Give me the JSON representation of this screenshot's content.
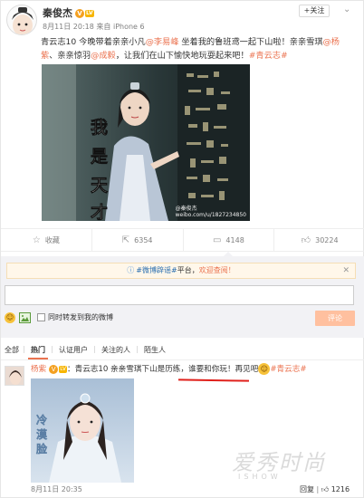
{
  "post": {
    "author": "秦俊杰",
    "time": "8月11日 20:18",
    "source_prefix": "来自",
    "source": "iPhone 6",
    "follow_label": "+关注",
    "text_line1_a": "青云志10 今晚带着亲亲小凡",
    "mention1": "@李易峰",
    "text_line1_b": " 坐着我的鲁班鸢一起下山啦！亲亲雪琪",
    "mention2": "@杨",
    "mention2_cont": "紫",
    "text_line2_a": "、亲亲惊羽",
    "mention3": "@成毅",
    "text_line2_b": "，让我们在山下愉快地玩耍起来吧！",
    "hashtag": "#青云志#",
    "image_caption": "我是天才",
    "image_watermark": "weibo.com/u/1827234850",
    "image_watermark2": "@秦俊杰"
  },
  "actions": {
    "favorite": "收藏",
    "repost": "6354",
    "comment": "4148",
    "like": "30224"
  },
  "comment_box": {
    "notice_link": "#微博辟谣#",
    "notice_text": "平台，",
    "notice_cta": "欢迎查阅！",
    "checkbox_label": "同时转发到我的微博",
    "submit_label": "评论"
  },
  "filters": {
    "all": "全部",
    "hot": "热门",
    "verified": "认证用户",
    "following": "关注的人",
    "strangers": "陌生人"
  },
  "comment": {
    "author": "杨紫",
    "text_a": "：青云志10 亲亲雪琪下山是历练，",
    "text_b": "谁要和你玩！再见吧",
    "hashtag": "#青云志#",
    "image_caption": "冷漠脸",
    "time": "8月11日 20:35",
    "reply_label": "回复",
    "likes": "1216"
  },
  "watermark": {
    "main": "爱秀时尚",
    "sub": "ISHOW"
  },
  "colors": {
    "accent": "#eb7350",
    "link": "#eb7350",
    "notice_bg": "#fff7ea",
    "submit_bg": "#ffc09f"
  }
}
